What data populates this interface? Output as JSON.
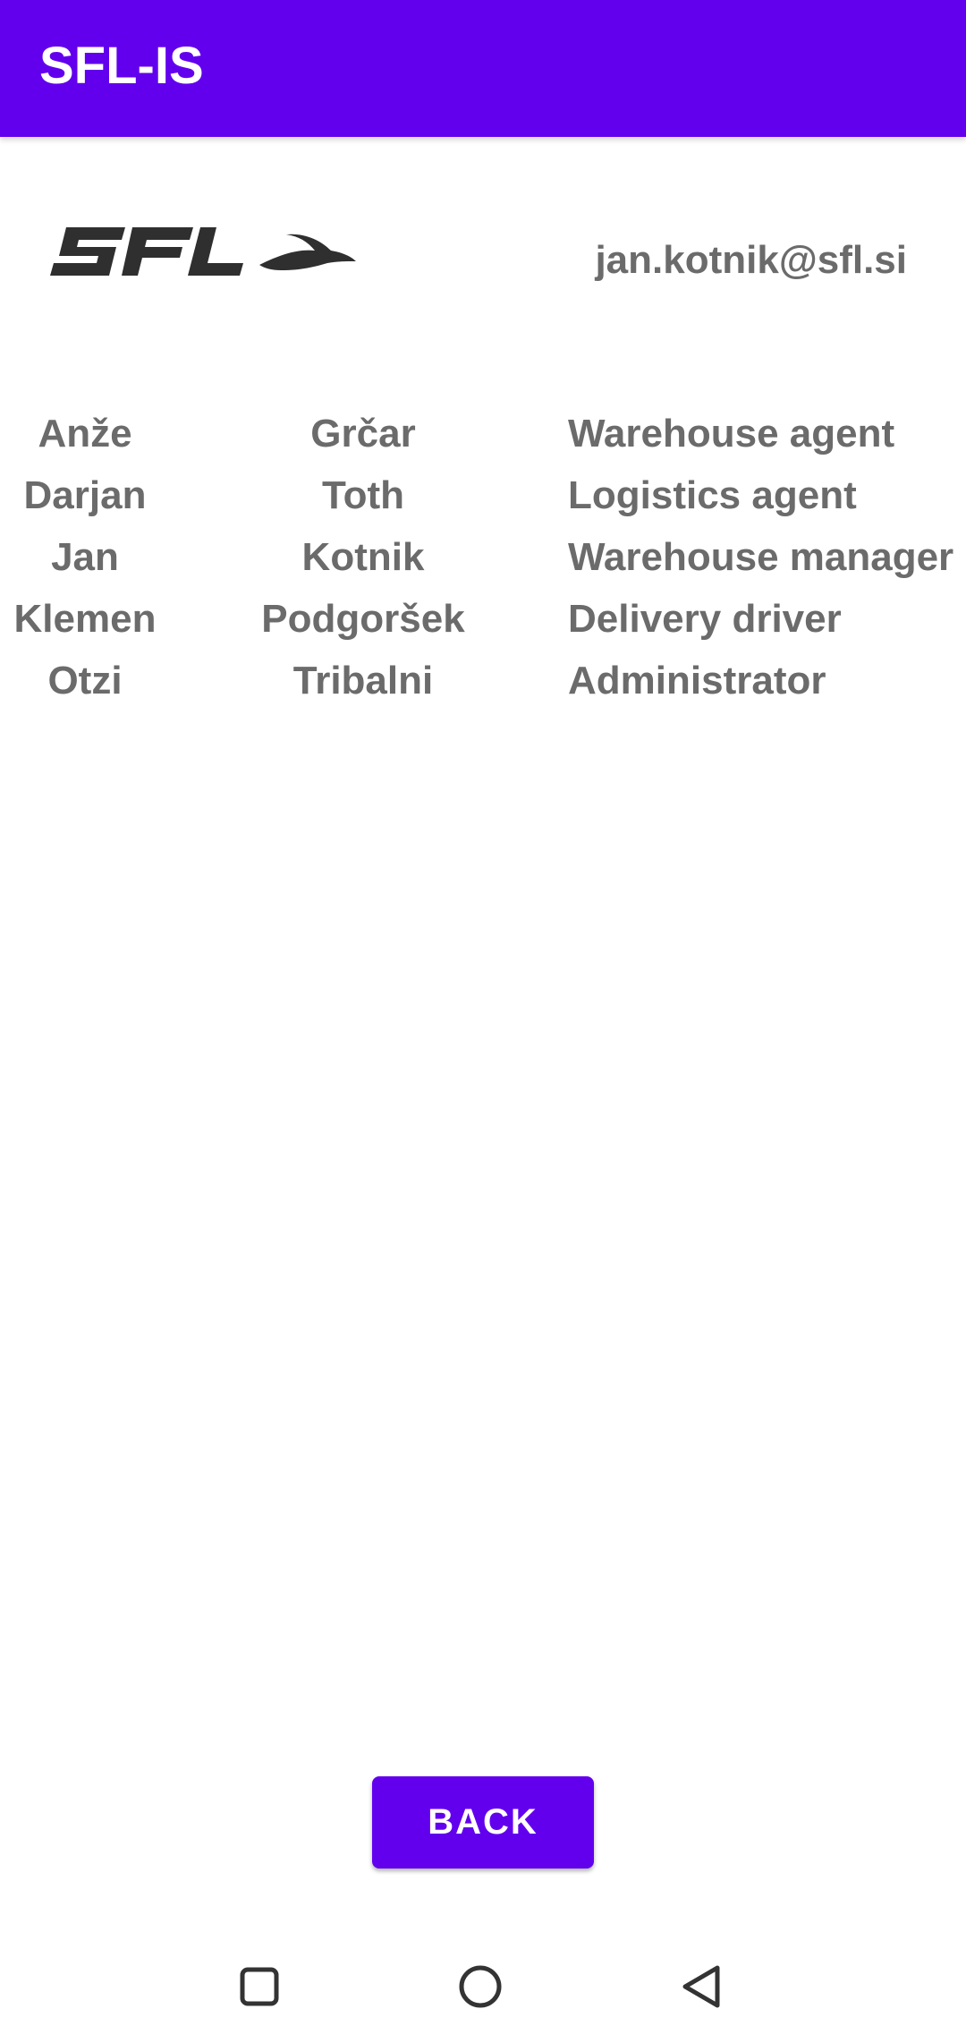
{
  "app_bar": {
    "title": "SFL-IS",
    "color": "#6200EE"
  },
  "header": {
    "logo_text": "SFL",
    "email": "jan.kotnik@sfl.si"
  },
  "users": [
    {
      "first_name": "Anže",
      "last_name": "Grčar",
      "role": "Warehouse agent"
    },
    {
      "first_name": "Darjan",
      "last_name": "Toth",
      "role": "Logistics agent"
    },
    {
      "first_name": "Jan",
      "last_name": "Kotnik",
      "role": "Warehouse manager"
    },
    {
      "first_name": "Klemen",
      "last_name": "Podgoršek",
      "role": "Delivery driver"
    },
    {
      "first_name": "Otzi",
      "last_name": "Tribalni",
      "role": "Administrator"
    }
  ],
  "footer": {
    "back_label": "BACK"
  },
  "nav_bar": {
    "icons": [
      "square-recents-icon",
      "circle-home-icon",
      "triangle-back-icon"
    ]
  }
}
